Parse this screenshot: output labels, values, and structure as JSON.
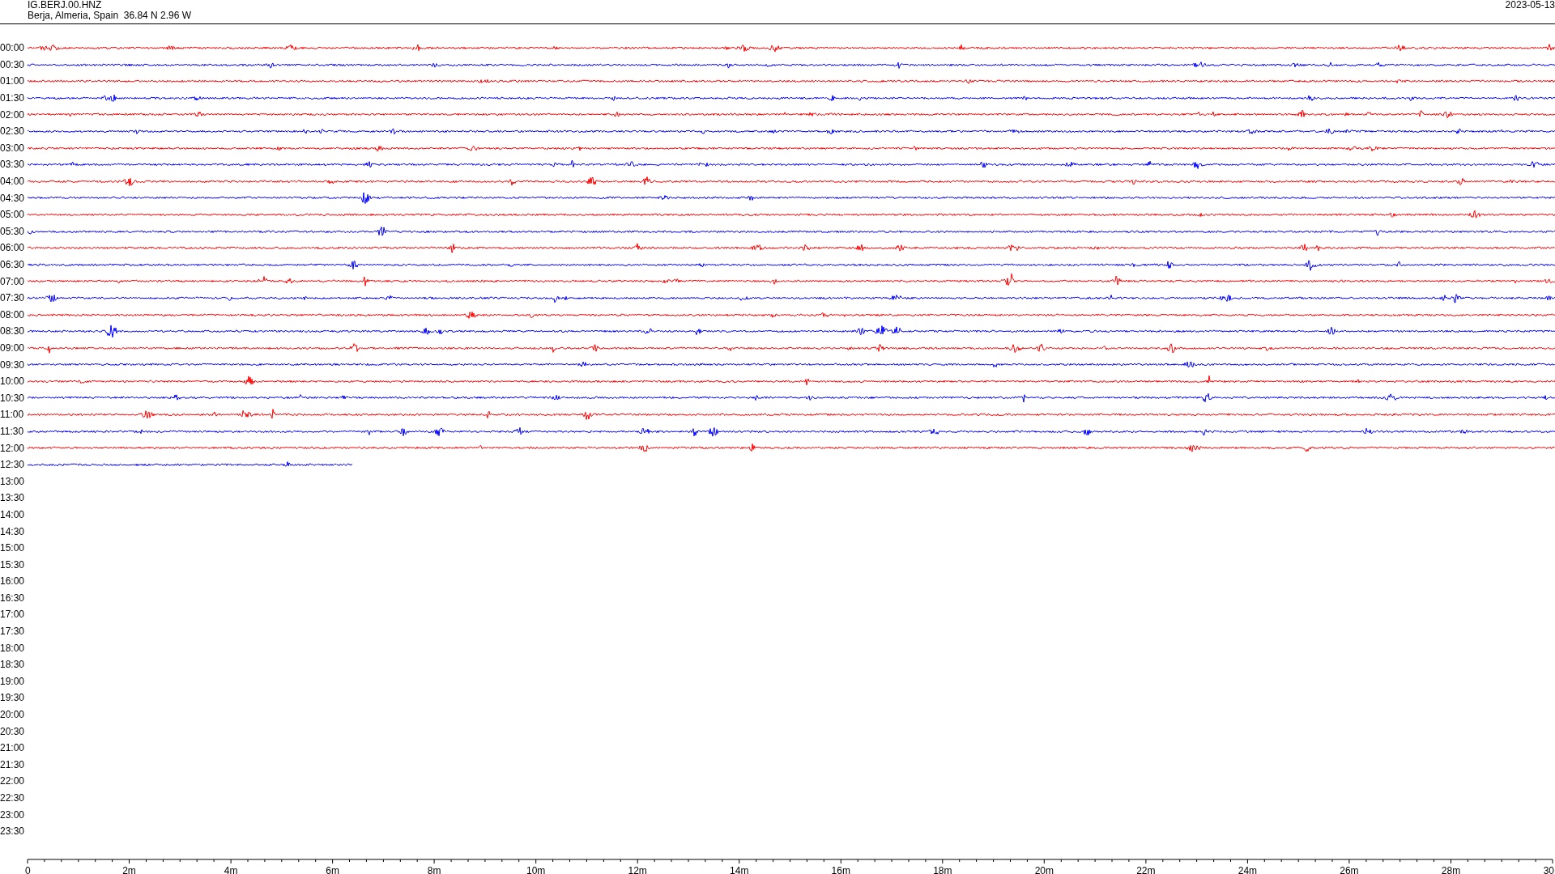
{
  "header": {
    "station": "IG.BERJ.00.HNZ",
    "location": "Berja, Almeria, Spain  36.84 N 2.96 W",
    "date": "2023-05-13"
  },
  "hours": [
    "00:00",
    "00:30",
    "01:00",
    "01:30",
    "02:00",
    "02:30",
    "03:00",
    "03:30",
    "04:00",
    "04:30",
    "05:00",
    "05:30",
    "06:00",
    "06:30",
    "07:00",
    "07:30",
    "08:00",
    "08:30",
    "09:00",
    "09:30",
    "10:00",
    "10:30",
    "11:00",
    "11:30",
    "12:00",
    "12:30",
    "13:00",
    "13:30",
    "14:00",
    "14:30",
    "15:00",
    "15:30",
    "16:00",
    "16:30",
    "17:00",
    "17:30",
    "18:00",
    "18:30",
    "19:00",
    "19:30",
    "20:00",
    "20:30",
    "21:00",
    "21:30",
    "22:00",
    "22:30",
    "23:00",
    "23:30"
  ],
  "traces": [
    {
      "color": "#ff0000",
      "complete": true
    },
    {
      "color": "#0000ff",
      "complete": true
    },
    {
      "color": "#ff0000",
      "complete": true
    },
    {
      "color": "#0000ff",
      "complete": true
    },
    {
      "color": "#ff0000",
      "complete": true
    },
    {
      "color": "#0000ff",
      "complete": true
    },
    {
      "color": "#ff0000",
      "complete": true
    },
    {
      "color": "#0000ff",
      "complete": true
    },
    {
      "color": "#ff0000",
      "complete": true
    },
    {
      "color": "#0000ff",
      "complete": true
    },
    {
      "color": "#ff0000",
      "complete": true
    },
    {
      "color": "#0000ff",
      "complete": true
    },
    {
      "color": "#ff0000",
      "complete": true
    },
    {
      "color": "#0000ff",
      "complete": true
    },
    {
      "color": "#ff0000",
      "complete": true
    },
    {
      "color": "#0000ff",
      "complete": true
    },
    {
      "color": "#ff0000",
      "complete": true
    },
    {
      "color": "#0000ff",
      "complete": true
    },
    {
      "color": "#ff0000",
      "complete": true
    },
    {
      "color": "#0000ff",
      "complete": true
    },
    {
      "color": "#ff0000",
      "complete": true
    },
    {
      "color": "#0000ff",
      "complete": true
    },
    {
      "color": "#ff0000",
      "complete": true
    },
    {
      "color": "#0000ff",
      "complete": true
    },
    {
      "color": "#ff0000",
      "complete": true
    },
    {
      "color": "#0000ff",
      "complete": false
    }
  ],
  "axis_labels": [
    "0",
    "2m",
    "4m",
    "6m",
    "8m",
    "10m",
    "12m",
    "14m",
    "16m",
    "18m",
    "20m",
    "22m",
    "24m",
    "26m",
    "28m",
    "30"
  ]
}
